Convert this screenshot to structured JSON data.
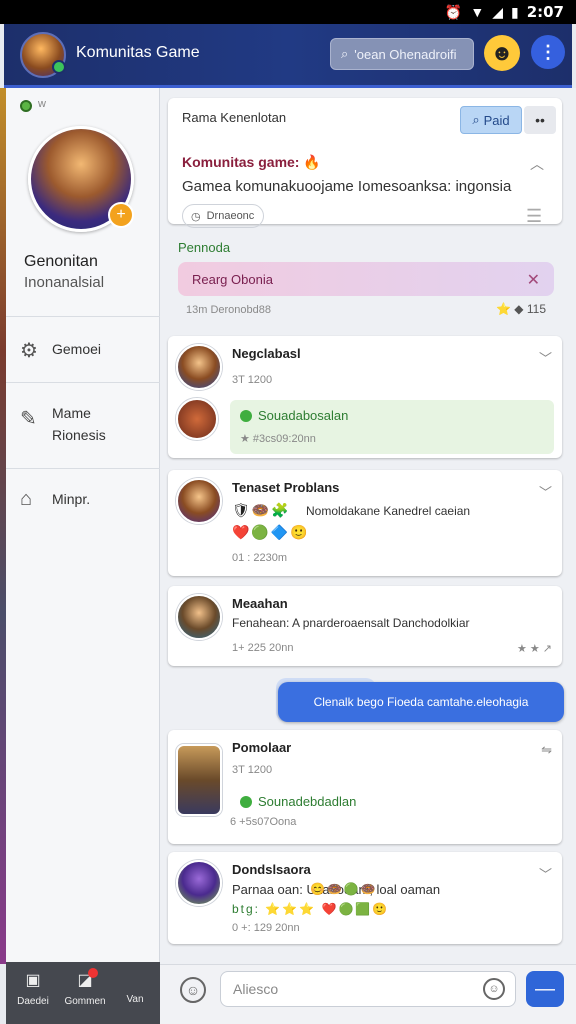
{
  "status_bar": {
    "time": "2:07"
  },
  "app_bar": {
    "title": "Komunitas Game",
    "search_placeholder": "'oean Ohenadroifi",
    "emoji_icon": "smile-icon",
    "more_icon": "more-vert-icon",
    "brand_color": "#213a84"
  },
  "sidebar": {
    "status_text": "w",
    "profile_name": "Genonitan",
    "profile_role": "Inonanalsial",
    "nav": [
      {
        "label": "Gemoei",
        "icon": "gamepad-icon"
      },
      {
        "label": "Mame Rionesis",
        "icon": "pencil-icon"
      },
      {
        "label": "Minpr.",
        "icon": "folder-icon"
      }
    ]
  },
  "bottom_nav": [
    {
      "label": "Daedei",
      "icon": "briefcase-icon"
    },
    {
      "label": "Gommen",
      "icon": "chat-icon"
    },
    {
      "label": "Van",
      "icon": "more-icon"
    }
  ],
  "community_header": {
    "title": "Rama Kenenlotan",
    "post_button": "Paid",
    "heading": "Komunitas game:",
    "description": "Gamea komunakuoojame Iomesoanksa: ingonsia",
    "chip": "Drnaeonc"
  },
  "pinned": {
    "section_title": "Pennoda",
    "text": "Rearg Obonia",
    "meta": "13m Deronobd88",
    "count": "115"
  },
  "posts": [
    {
      "name": "Negclabasl",
      "time": "3T 1200",
      "reply_text": "Souadabosalan",
      "reply_meta": "★ #3cs09:20nn"
    },
    {
      "name": "Tenaset Problans",
      "text": "Nomoldakane Kanedrel caeian",
      "time": "01 : 2230m"
    },
    {
      "name": "Meaahan",
      "text": "Fenahean: A pnarderoaensalt  Danchodolkiar",
      "time": "1+ 225 20nn"
    },
    {
      "name": "Pomolaar",
      "time": "3T 1200",
      "reply_text": "Sounadebdadlan",
      "reply_meta": "6 +5s07Oona"
    },
    {
      "name": "Dondslsaora",
      "text": "Parnaa oan: Ukanodam, loal oaman",
      "tag": "btg:",
      "time": "0 +: 129 20nn"
    }
  ],
  "chat_bubble": {
    "text": "Clenalk bego Fioeda camtahe.eleohagia"
  },
  "composer": {
    "placeholder": "Aliesco"
  }
}
